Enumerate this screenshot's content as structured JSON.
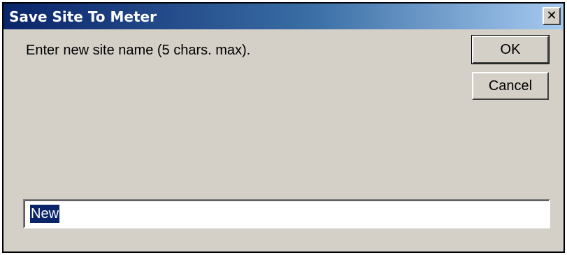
{
  "dialog": {
    "title": "Save Site To Meter",
    "close_glyph": "✕",
    "close_icon": "close-icon",
    "prompt": "Enter new site name (5 chars. max).",
    "ok_label": "OK",
    "cancel_label": "Cancel",
    "site_name_value": "New",
    "colors": {
      "titlebar_start": "#0a246a",
      "titlebar_end": "#a6caf0",
      "face": "#d4d0c8",
      "selection": "#0a246a"
    }
  }
}
